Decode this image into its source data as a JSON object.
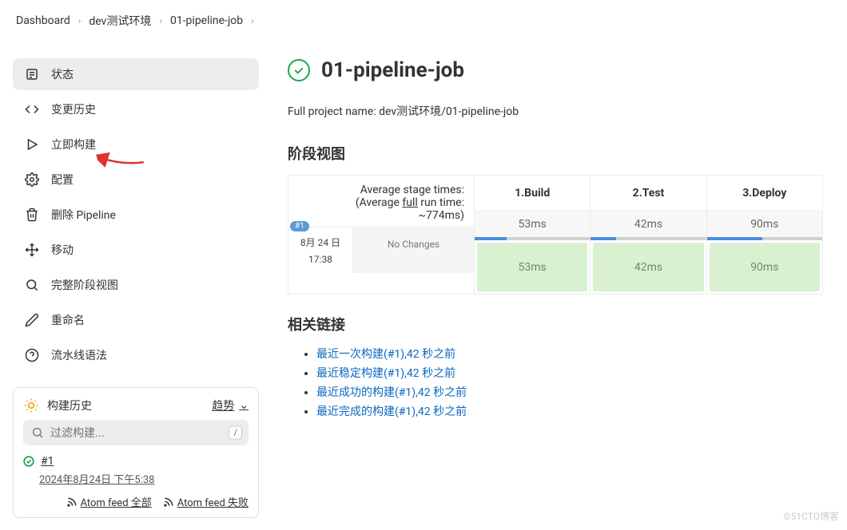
{
  "breadcrumb": {
    "items": [
      "Dashboard",
      "dev测试环境",
      "01-pipeline-job"
    ]
  },
  "sidebar": {
    "items": [
      {
        "label": "状态",
        "icon": "status-icon"
      },
      {
        "label": "变更历史",
        "icon": "code-icon"
      },
      {
        "label": "立即构建",
        "icon": "play-icon"
      },
      {
        "label": "配置",
        "icon": "gear-icon"
      },
      {
        "label": "删除 Pipeline",
        "icon": "trash-icon"
      },
      {
        "label": "移动",
        "icon": "move-icon"
      },
      {
        "label": "完整阶段视图",
        "icon": "search-icon"
      },
      {
        "label": "重命名",
        "icon": "edit-icon"
      },
      {
        "label": "流水线语法",
        "icon": "help-icon"
      }
    ]
  },
  "buildHistory": {
    "title": "构建历史",
    "trend": "趋势",
    "filterPlaceholder": "过滤构建...",
    "shortcut": "/",
    "run": {
      "num": "#1",
      "date": "2024年8月24日 下午5:38"
    },
    "feeds": {
      "all": "Atom feed 全部",
      "fail": "Atom feed 失败"
    }
  },
  "main": {
    "title": "01-pipeline-job",
    "fullNameLabel": "Full project name: dev测试环境/01-pipeline-job",
    "stageViewTitle": "阶段视图",
    "avgLabel1": "Average stage times:",
    "avgLabel2a": "(Average ",
    "avgLabel2b": "full",
    "avgLabel2c": " run time:",
    "avgLabel3": "~774ms)",
    "runBadge": "#1",
    "runDateLine1": "8月 24 日",
    "runDateLine2": "17:38",
    "noChanges": "No Changes",
    "stages": [
      {
        "name": "1.Build",
        "avg": "53ms",
        "val": "53ms",
        "fill": 28
      },
      {
        "name": "2.Test",
        "avg": "42ms",
        "val": "42ms",
        "fill": 22
      },
      {
        "name": "3.Deploy",
        "avg": "90ms",
        "val": "90ms",
        "fill": 48
      }
    ],
    "linksTitle": "相关链接",
    "links": [
      "最近一次构建(#1),42 秒之前",
      "最近稳定构建(#1),42 秒之前",
      "最近成功的构建(#1),42 秒之前",
      "最近完成的构建(#1),42 秒之前"
    ]
  },
  "watermark": "©51CTO博客"
}
